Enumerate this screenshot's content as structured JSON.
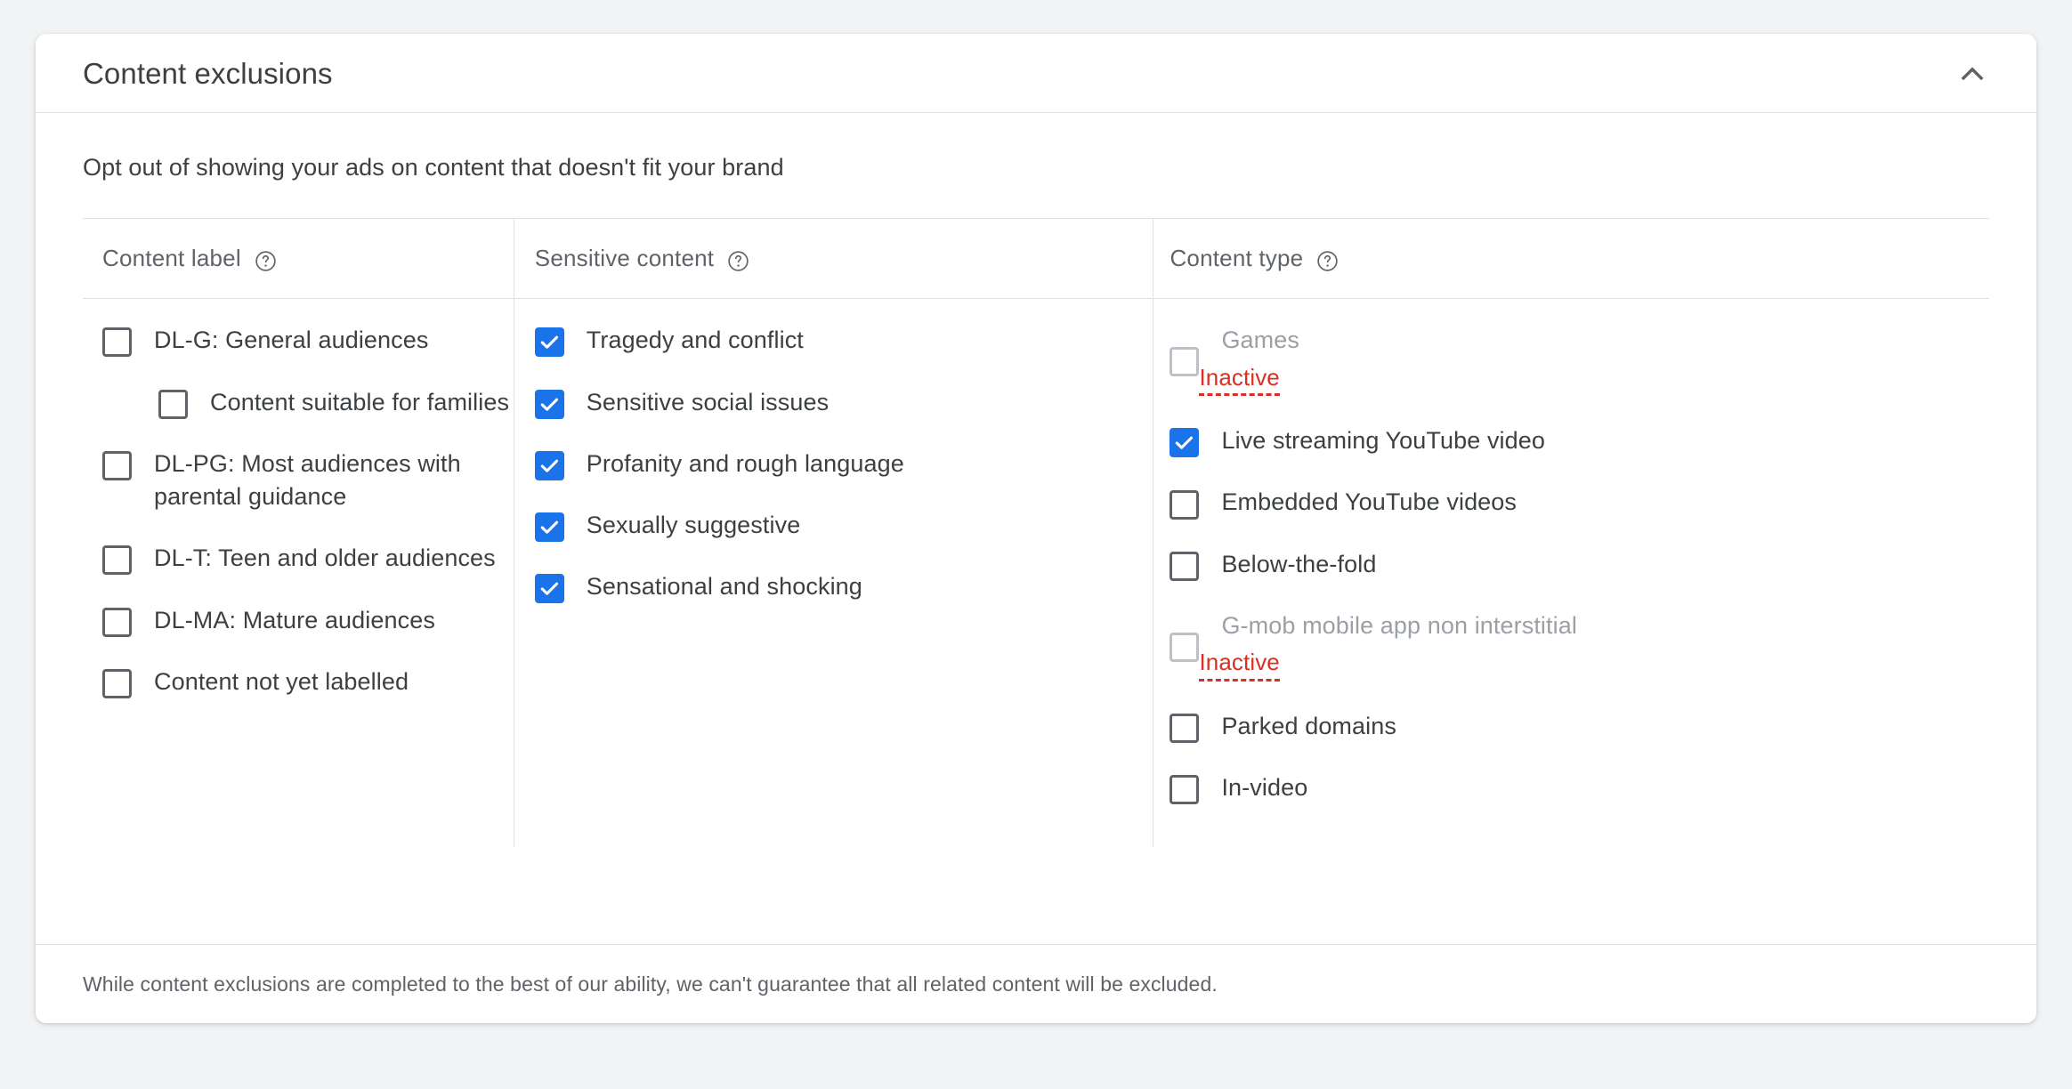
{
  "card": {
    "title": "Content exclusions",
    "collapse_icon": "chevron-up-icon",
    "subtitle": "Opt out of showing your ads on content that doesn't fit your brand",
    "footer_note": "While content exclusions are completed to the best of our ability, we can't guarantee that all related content will be excluded."
  },
  "colors": {
    "accent": "#1a73e8",
    "inactive": "#d93025",
    "text": "#3c4043",
    "muted": "#5f6368",
    "disabled": "#9aa0a6",
    "border": "#e0e0e0",
    "page_bg": "#f1f3f4"
  },
  "columns": [
    {
      "header": "Content label",
      "help_icon": "help-circle-icon",
      "items": [
        {
          "label": "DL-G: General audiences",
          "checked": false,
          "disabled": false,
          "indent": false,
          "status": ""
        },
        {
          "label": "Content suitable for families",
          "checked": false,
          "disabled": false,
          "indent": true,
          "status": ""
        },
        {
          "label": "DL-PG: Most audiences with parental guidance",
          "checked": false,
          "disabled": false,
          "indent": false,
          "status": ""
        },
        {
          "label": "DL-T: Teen and older audiences",
          "checked": false,
          "disabled": false,
          "indent": false,
          "status": ""
        },
        {
          "label": "DL-MA: Mature audiences",
          "checked": false,
          "disabled": false,
          "indent": false,
          "status": ""
        },
        {
          "label": "Content not yet labelled",
          "checked": false,
          "disabled": false,
          "indent": false,
          "status": ""
        }
      ]
    },
    {
      "header": "Sensitive content",
      "help_icon": "help-circle-icon",
      "items": [
        {
          "label": "Tragedy and conflict",
          "checked": true,
          "disabled": false,
          "indent": false,
          "status": ""
        },
        {
          "label": "Sensitive social issues",
          "checked": true,
          "disabled": false,
          "indent": false,
          "status": ""
        },
        {
          "label": "Profanity and rough language",
          "checked": true,
          "disabled": false,
          "indent": false,
          "status": ""
        },
        {
          "label": "Sexually suggestive",
          "checked": true,
          "disabled": false,
          "indent": false,
          "status": ""
        },
        {
          "label": "Sensational and shocking",
          "checked": true,
          "disabled": false,
          "indent": false,
          "status": ""
        }
      ]
    },
    {
      "header": "Content type",
      "help_icon": "help-circle-icon",
      "items": [
        {
          "label": "Games",
          "checked": false,
          "disabled": true,
          "indent": false,
          "status": "Inactive"
        },
        {
          "label": "Live streaming YouTube video",
          "checked": true,
          "disabled": false,
          "indent": false,
          "status": ""
        },
        {
          "label": "Embedded YouTube videos",
          "checked": false,
          "disabled": false,
          "indent": false,
          "status": ""
        },
        {
          "label": "Below-the-fold",
          "checked": false,
          "disabled": false,
          "indent": false,
          "status": ""
        },
        {
          "label": "G-mob mobile app non interstitial",
          "checked": false,
          "disabled": true,
          "indent": false,
          "status": "Inactive"
        },
        {
          "label": "Parked domains",
          "checked": false,
          "disabled": false,
          "indent": false,
          "status": ""
        },
        {
          "label": "In-video",
          "checked": false,
          "disabled": false,
          "indent": false,
          "status": ""
        }
      ]
    }
  ]
}
